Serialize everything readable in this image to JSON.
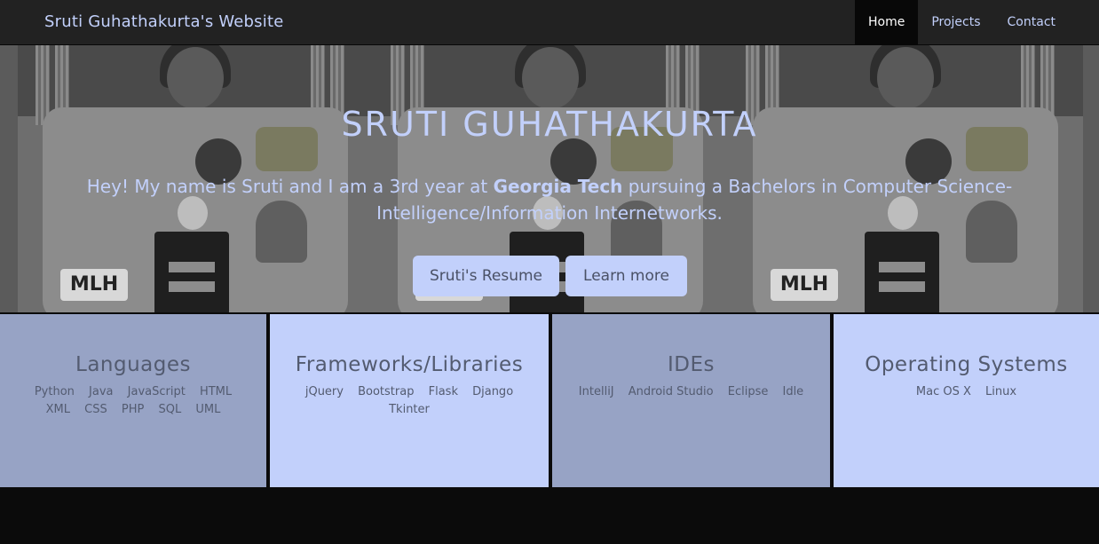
{
  "nav": {
    "brand": "Sruti Guhathakurta's Website",
    "items": [
      {
        "label": "Home",
        "active": true
      },
      {
        "label": "Projects",
        "active": false
      },
      {
        "label": "Contact",
        "active": false
      }
    ]
  },
  "hero": {
    "title": "SRUTI GUHATHAKURTA",
    "intro_before": "Hey! My name is Sruti and I am a 3rd year at ",
    "intro_bold": "Georgia Tech",
    "intro_after": " pursuing a Bachelors in Computer Science-Intelligence/Information Internetworks.",
    "resume_button": "Sruti's Resume",
    "learn_button": "Learn more",
    "photo_sticker_text": "MLH"
  },
  "skills": {
    "languages": {
      "title": "Languages",
      "items": [
        "Python",
        "Java",
        "JavaScript",
        "HTML",
        "XML",
        "CSS",
        "PHP",
        "SQL",
        "UML"
      ]
    },
    "frameworks": {
      "title": "Frameworks/Libraries",
      "items": [
        "jQuery",
        "Bootstrap",
        "Flask",
        "Django",
        "Tkinter"
      ]
    },
    "ides": {
      "title": "IDEs",
      "items": [
        "IntelliJ",
        "Android Studio",
        "Eclipse",
        "Idle"
      ]
    },
    "os": {
      "title": "Operating Systems",
      "items": [
        "Mac OS X",
        "Linux"
      ]
    }
  },
  "colors": {
    "accent": "#c2d0fb",
    "card_dark": "#97a3c5",
    "card_text": "#535b70",
    "navbar": "#222222"
  }
}
